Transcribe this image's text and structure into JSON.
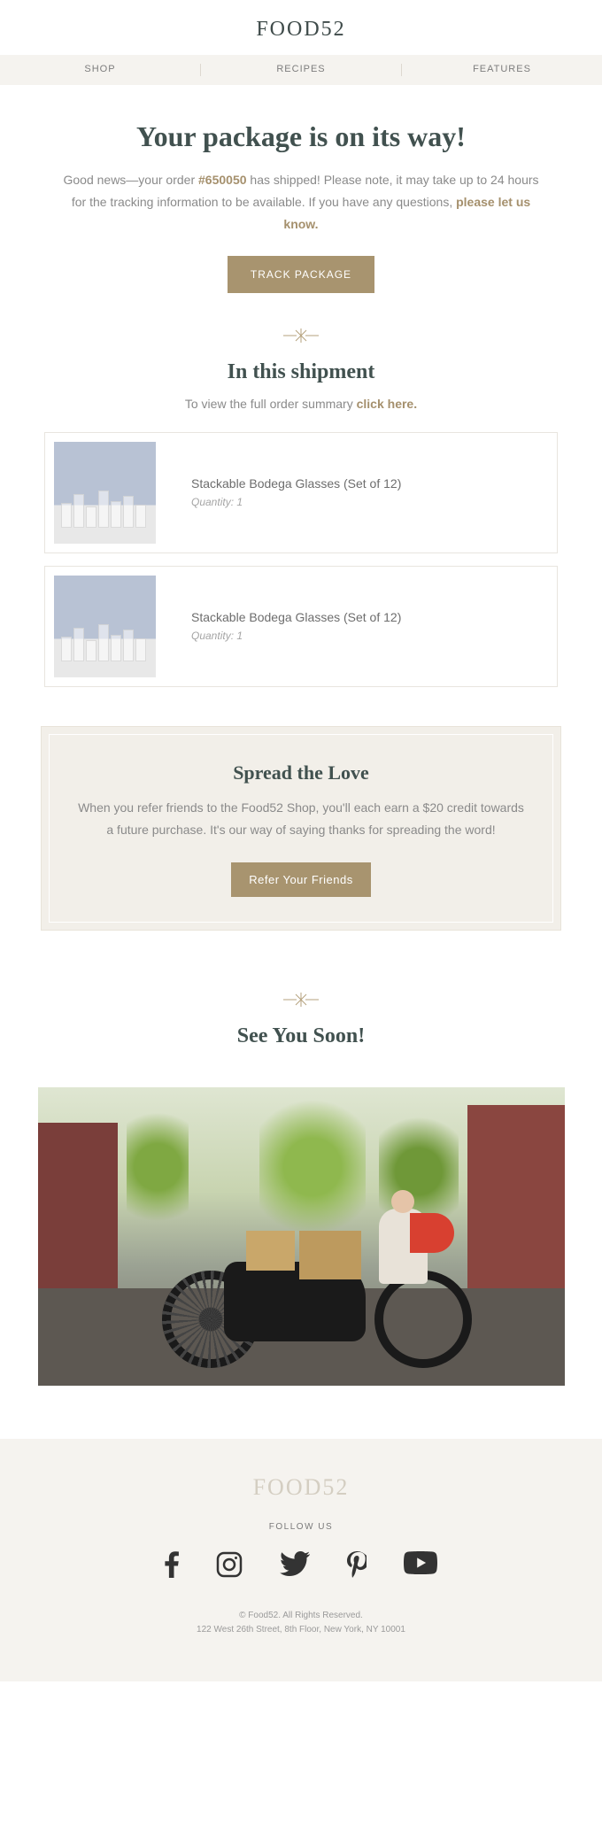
{
  "header": {
    "logo": "FOOD52"
  },
  "nav": {
    "items": [
      "SHOP",
      "RECIPES",
      "FEATURES"
    ]
  },
  "hero": {
    "title": "Your package is on its way!",
    "pre_text": "Good news—your order ",
    "order_num": "#650050",
    "mid_text": " has shipped! Please note, it may take up to 24 hours for the tracking information to be available. If you have any questions, ",
    "link_text": "please let us know.",
    "button": "TRACK PACKAGE"
  },
  "shipment": {
    "title": "In this shipment",
    "sub_pre": "To view the full order summary ",
    "sub_link": "click here.",
    "items": [
      {
        "name": "Stackable Bodega Glasses (Set of 12)",
        "qty": "Quantity: 1"
      },
      {
        "name": "Stackable Bodega Glasses (Set of 12)",
        "qty": "Quantity: 1"
      }
    ]
  },
  "spread": {
    "title": "Spread the Love",
    "text": "When you refer friends to the Food52 Shop, you'll each earn a $20 credit towards a future purchase. It's our way of saying thanks for spreading the word!",
    "button": "Refer Your Friends"
  },
  "see_soon": {
    "title": "See You Soon!"
  },
  "footer": {
    "logo": "FOOD52",
    "follow": "FOLLOW US",
    "copyright": "© Food52. All Rights Reserved.",
    "address": "122 West 26th Street, 8th Floor, New York, NY 10001"
  }
}
